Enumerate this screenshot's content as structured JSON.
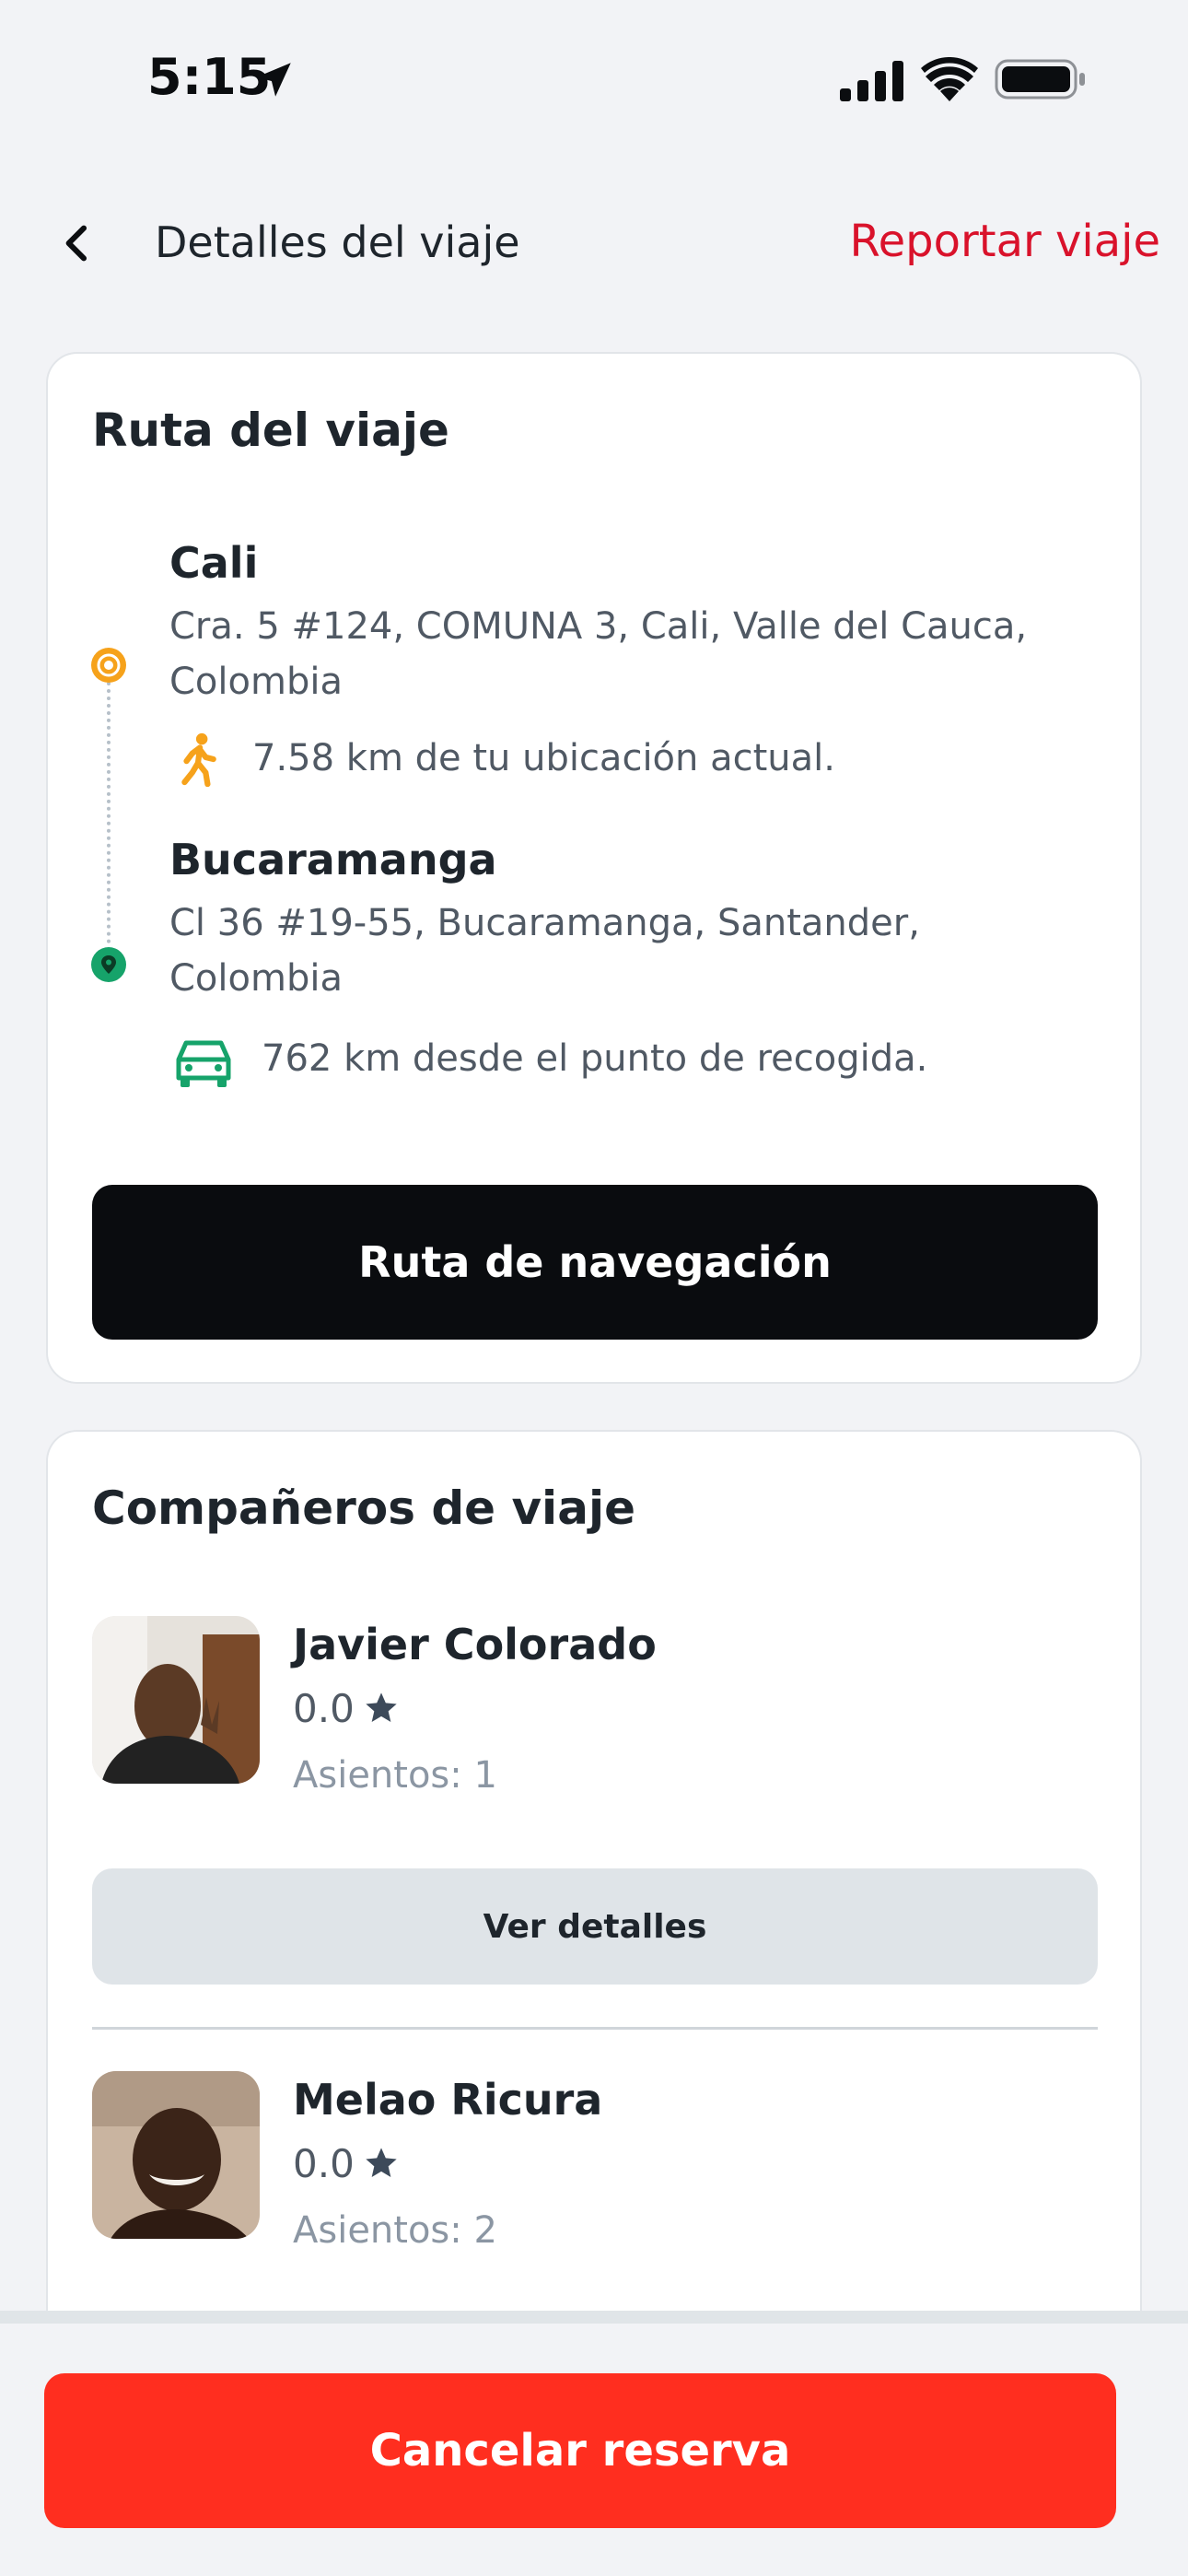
{
  "status_bar": {
    "time": "5:15",
    "icons": [
      "location-arrow-icon",
      "cellular-signal-icon",
      "wifi-icon",
      "battery-icon"
    ]
  },
  "header": {
    "back_icon": "chevron-left-icon",
    "title": "Detalles del viaje",
    "report_label": "Reportar viaje"
  },
  "route": {
    "title": "Ruta del viaje",
    "origin": {
      "city": "Cali",
      "address": "Cra. 5 #124, COMUNA 3, Cali, Valle del Cauca, Colombia",
      "distance_text": "7.58 km de tu ubicación actual.",
      "icon": "walking-person-icon"
    },
    "destination": {
      "city": "Bucaramanga",
      "address": "Cl 36 #19-55, Bucaramanga, Santander, Colombia",
      "distance_text": "762 km desde el punto de recogida.",
      "icon": "car-icon"
    },
    "nav_button_label": "Ruta de navegación"
  },
  "companions": {
    "title": "Compañeros de viaje",
    "items": [
      {
        "name": "Javier Colorado",
        "rating": "0.0",
        "seats": "Asientos: 1"
      },
      {
        "name": "Melao Ricura",
        "rating": "0.0",
        "seats": "Asientos: 2"
      }
    ],
    "details_button_label": "Ver detalles"
  },
  "footer": {
    "cancel_label": "Cancelar reserva"
  },
  "colors": {
    "accent_red": "#d9122b",
    "cancel_red": "#ff2e1f",
    "origin_orange": "#f6a21b",
    "destination_green": "#16a36a"
  }
}
